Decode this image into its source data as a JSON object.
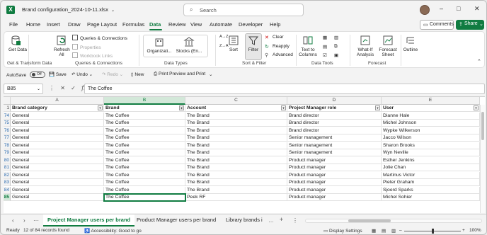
{
  "title_bar": {
    "file_name": "Brand configuration_2024-10-11.xlsx",
    "search_placeholder": "Search"
  },
  "menu": {
    "tabs": [
      "File",
      "Home",
      "Insert",
      "Draw",
      "Page Layout",
      "Formulas",
      "Data",
      "Review",
      "View",
      "Automate",
      "Developer",
      "Help"
    ],
    "active_tab": "Data",
    "comments_label": "Comments",
    "share_label": "Share"
  },
  "ribbon": {
    "get_data": "Get Data",
    "refresh_all": "Refresh All",
    "queries_connections": "Queries & Connections",
    "properties": "Properties",
    "workbook_links": "Workbook Links",
    "organization": "Organizati...",
    "stocks": "Stocks (En...",
    "sort_asc": "A→Z",
    "sort_desc": "Z→A",
    "sort": "Sort",
    "filter": "Filter",
    "clear": "Clear",
    "reapply": "Reapply",
    "advanced": "Advanced",
    "text_to_columns": "Text to Columns",
    "what_if": "What-If Analysis",
    "forecast_sheet": "Forecast Sheet",
    "outline": "Outline",
    "groups": {
      "get_transform": "Get & Transform Data",
      "queries": "Queries & Connections",
      "data_types": "Data Types",
      "sort_filter": "Sort & Filter",
      "data_tools": "Data Tools",
      "forecast": "Forecast"
    }
  },
  "quick_access": {
    "autosave": "AutoSave",
    "autosave_state": "Off",
    "save": "Save",
    "undo": "Undo",
    "redo": "Redo",
    "new": "New",
    "print_preview": "Print Preview and Print"
  },
  "formula_bar": {
    "name_box": "B85",
    "fx": "fx",
    "value": "The Coffee"
  },
  "sheet": {
    "columns": [
      "A",
      "B",
      "C",
      "D",
      "E"
    ],
    "header_row": "1",
    "headers": [
      "Brand category",
      "Brand",
      "Account",
      "Project Manager role",
      "User"
    ],
    "rows": [
      {
        "num": "74",
        "cells": [
          "General",
          "The Coffee",
          "The Brand",
          "Brand director",
          "Dianne Hale"
        ]
      },
      {
        "num": "75",
        "cells": [
          "General",
          "The Coffee",
          "The Brand",
          "Brand director",
          "Michel Johnson"
        ]
      },
      {
        "num": "76",
        "cells": [
          "General",
          "The Coffee",
          "The Brand",
          "Brand director",
          "Wypke Wilkerson"
        ]
      },
      {
        "num": "77",
        "cells": [
          "General",
          "The Coffee",
          "The Brand",
          "Senior management",
          "Jacco Wilson"
        ]
      },
      {
        "num": "78",
        "cells": [
          "General",
          "The Coffee",
          "The Brand",
          "Senior management",
          "Sharon Brooks"
        ]
      },
      {
        "num": "79",
        "cells": [
          "General",
          "The Coffee",
          "The Brand",
          "Senior management",
          "Wyn Neville"
        ]
      },
      {
        "num": "80",
        "cells": [
          "General",
          "The Coffee",
          "The Brand",
          "Product manager",
          "Esther Jenkins"
        ]
      },
      {
        "num": "81",
        "cells": [
          "General",
          "The Coffee",
          "The Brand",
          "Product manager",
          "Jolie Chan"
        ]
      },
      {
        "num": "82",
        "cells": [
          "General",
          "The Coffee",
          "The Brand",
          "Product manager",
          "Martinus Victor"
        ]
      },
      {
        "num": "83",
        "cells": [
          "General",
          "The Coffee",
          "The Brand",
          "Product manager",
          "Pieter Graham"
        ]
      },
      {
        "num": "84",
        "cells": [
          "General",
          "The Coffee",
          "The Brand",
          "Product manager",
          "Sjoerd Sparks"
        ]
      },
      {
        "num": "85",
        "cells": [
          "General",
          "The Coffee",
          "Peek RF",
          "Product manager",
          "Michel Sohier"
        ]
      }
    ]
  },
  "sheet_tabs": {
    "tabs": [
      "Project Manager users per brand",
      "Product Manager users per brand",
      "Library brands i"
    ],
    "active": "Project Manager users per brand"
  },
  "status_bar": {
    "ready": "Ready",
    "records": "12 of 84 records found",
    "accessibility": "Accessibility: Good to go",
    "display_settings": "Display Settings",
    "zoom": "100%"
  }
}
